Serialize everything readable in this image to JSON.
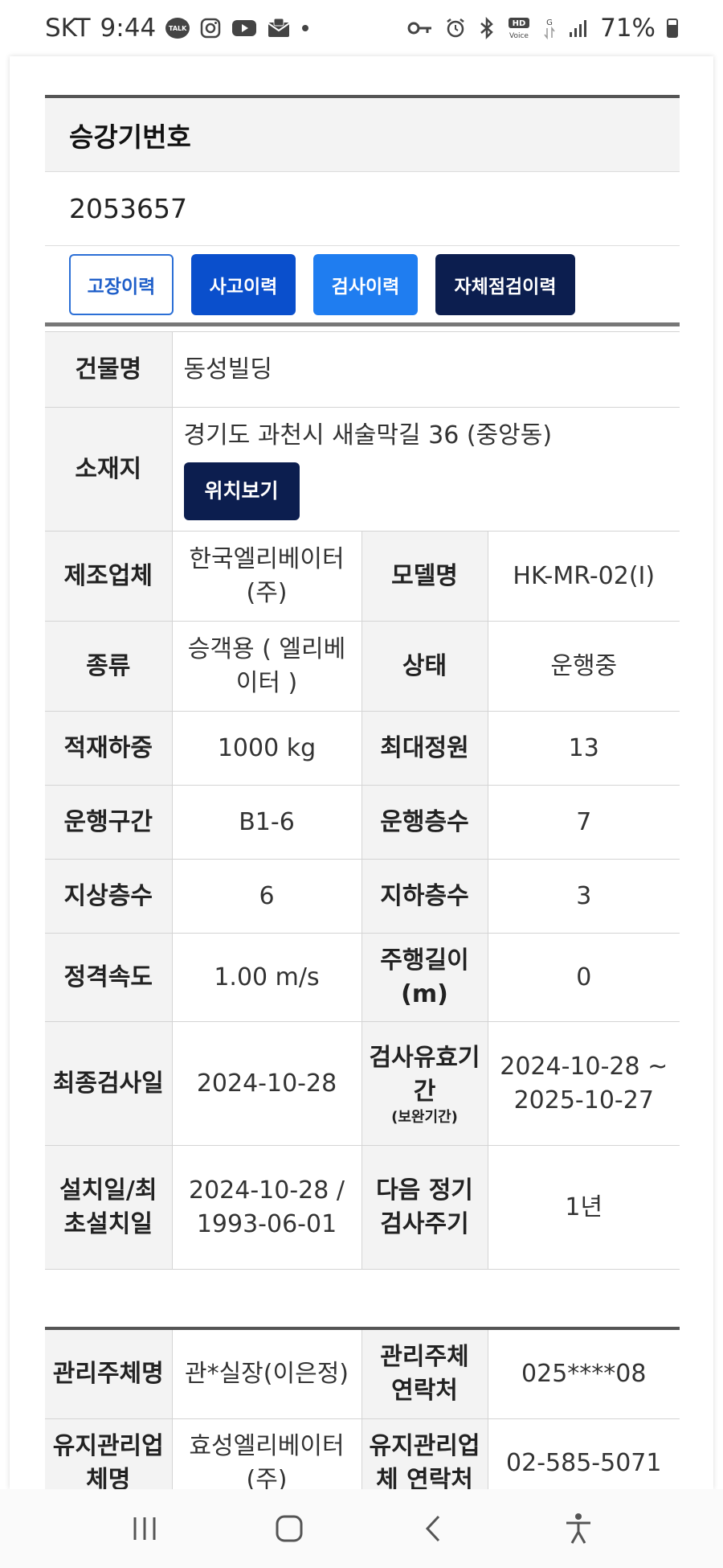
{
  "status_bar": {
    "carrier": "SKT",
    "time": "9:44",
    "battery": "71%",
    "left_icons": [
      "talk-icon",
      "instagram-icon",
      "youtube-icon",
      "naver-mail-icon",
      "dot-icon"
    ],
    "right_icons": [
      "key-icon",
      "alarm-icon",
      "bluetooth-icon",
      "hd-voice-icon",
      "data-icon",
      "signal-icon",
      "battery-icon"
    ]
  },
  "elevator": {
    "section_title": "승강기번호",
    "number": "2053657",
    "buttons": {
      "failure": "고장이력",
      "accident": "사고이력",
      "inspection": "검사이력",
      "self_check": "자체점검이력"
    }
  },
  "details": {
    "building_label": "건물명",
    "building": "동성빌딩",
    "location_label": "소재지",
    "location": "경기도 과천시 새술막길 36 (중앙동)",
    "location_button": "위치보기",
    "manufacturer_label": "제조업체",
    "manufacturer": "한국엘리베이터(주)",
    "model_label": "모델명",
    "model": "HK-MR-02(I)",
    "type_label": "종류",
    "type": "승객용 ( 엘리베이터 )",
    "status_label": "상태",
    "status": "운행중",
    "load_label": "적재하중",
    "load": "1000 kg",
    "capacity_label": "최대정원",
    "capacity": "13",
    "section_label": "운행구간",
    "section": "B1-6",
    "floors_served_label": "운행층수",
    "floors_served": "7",
    "above_floors_label": "지상층수",
    "above_floors": "6",
    "below_floors_label": "지하층수",
    "below_floors": "3",
    "speed_label": "정격속도",
    "speed": "1.00 m/s",
    "travel_label": "주행길이(m)",
    "travel": "0",
    "last_inspection_label": "최종검사일",
    "last_inspection": "2024-10-28",
    "validity_label": "검사유효기간",
    "validity_sub": "(보완기간)",
    "validity": "2024-10-28 ~ 2025-10-27",
    "install_label": "설치일/최초설치일",
    "install": "2024-10-28 / 1993-06-01",
    "cycle_label": "다음 정기 검사주기",
    "cycle": "1년"
  },
  "management": {
    "manager_label": "관리주체명",
    "manager": "관*실장(이은정)",
    "manager_contact_label": "관리주체 연락처",
    "manager_contact": "025****08",
    "maintenance_label": "유지관리업체명",
    "maintenance": "효성엘리베이터(주)",
    "maintenance_contact_label": "유지관리업체 연락처",
    "maintenance_contact": "02-585-5071"
  },
  "nav_bar": {
    "icons": [
      "recent-apps-icon",
      "home-icon",
      "back-icon",
      "accessibility-icon"
    ]
  }
}
